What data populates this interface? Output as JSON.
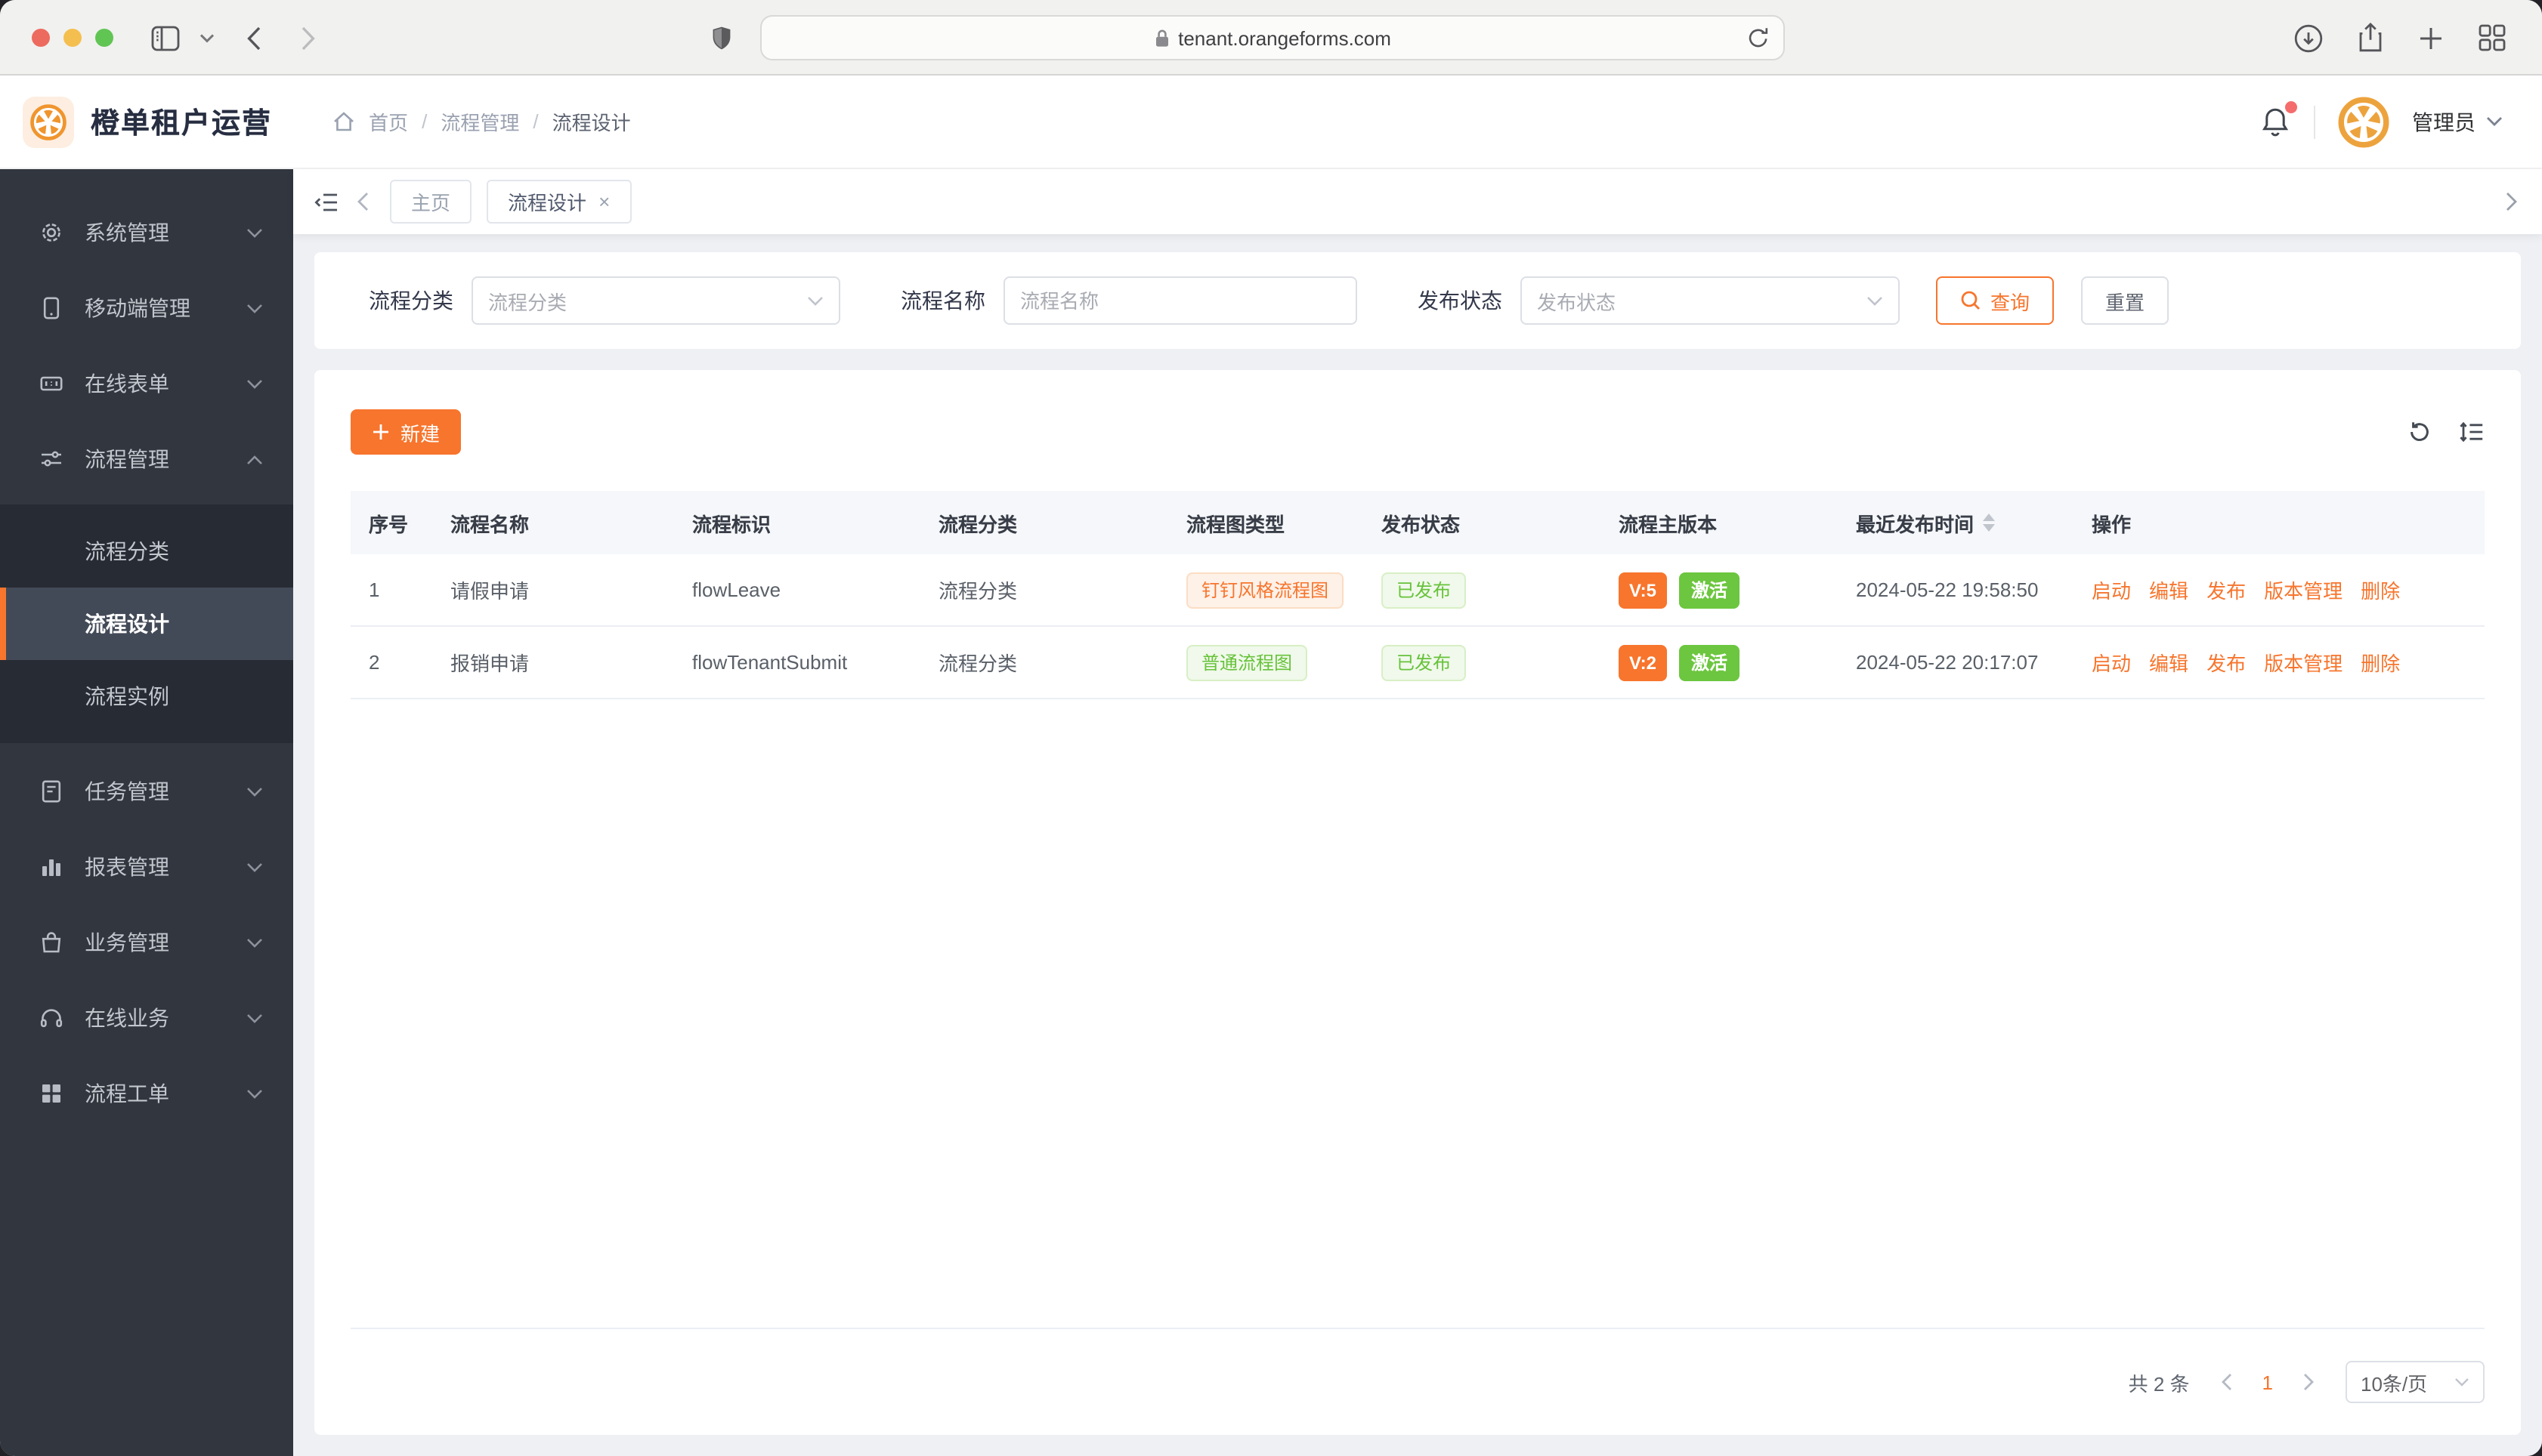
{
  "browser": {
    "url": "tenant.orangeforms.com"
  },
  "app": {
    "title": "橙单租户运营",
    "user_name": "管理员"
  },
  "breadcrumb": {
    "items": [
      "首页",
      "流程管理",
      "流程设计"
    ]
  },
  "sidebar": {
    "items": [
      {
        "label": "系统管理",
        "icon": "gear-icon"
      },
      {
        "label": "移动端管理",
        "icon": "mobile-icon"
      },
      {
        "label": "在线表单",
        "icon": "form-icon"
      },
      {
        "label": "流程管理",
        "icon": "sliders-icon",
        "expanded": true
      },
      {
        "label": "任务管理",
        "icon": "task-icon"
      },
      {
        "label": "报表管理",
        "icon": "bar-chart-icon"
      },
      {
        "label": "业务管理",
        "icon": "bag-icon"
      },
      {
        "label": "在线业务",
        "icon": "headset-icon"
      },
      {
        "label": "流程工单",
        "icon": "grid-icon"
      }
    ],
    "submenu": [
      {
        "label": "流程分类",
        "active": false
      },
      {
        "label": "流程设计",
        "active": true
      },
      {
        "label": "流程实例",
        "active": false
      }
    ]
  },
  "tabs": {
    "items": [
      {
        "label": "主页"
      },
      {
        "label": "流程设计",
        "closable": true
      }
    ]
  },
  "filters": {
    "category_label": "流程分类",
    "category_placeholder": "流程分类",
    "name_label": "流程名称",
    "name_placeholder": "流程名称",
    "status_label": "发布状态",
    "status_placeholder": "发布状态",
    "search": "查询",
    "reset": "重置"
  },
  "toolbar": {
    "create": "新建"
  },
  "table": {
    "headers": [
      "序号",
      "流程名称",
      "流程标识",
      "流程分类",
      "流程图类型",
      "发布状态",
      "流程主版本",
      "最近发布时间",
      "操作"
    ],
    "rows": [
      {
        "index": "1",
        "name": "请假申请",
        "key": "flowLeave",
        "category": "流程分类",
        "diagram": "钉钉风格流程图",
        "status": "已发布",
        "version": "V:5",
        "state": "激活",
        "published_at": "2024-05-22 19:58:50",
        "actions": [
          "启动",
          "编辑",
          "发布",
          "版本管理",
          "删除"
        ]
      },
      {
        "index": "2",
        "name": "报销申请",
        "key": "flowTenantSubmit",
        "category": "流程分类",
        "diagram": "普通流程图",
        "status": "已发布",
        "version": "V:2",
        "state": "激活",
        "published_at": "2024-05-22 20:17:07",
        "actions": [
          "启动",
          "编辑",
          "发布",
          "版本管理",
          "删除"
        ]
      }
    ]
  },
  "pagination": {
    "total": "共 2 条",
    "page": "1",
    "page_size": "10条/页"
  },
  "colors": {
    "primary": "#f7752d",
    "success": "#67c23a",
    "sidebar_bg": "#31363f",
    "active_tag_green": "#6cc63f"
  }
}
